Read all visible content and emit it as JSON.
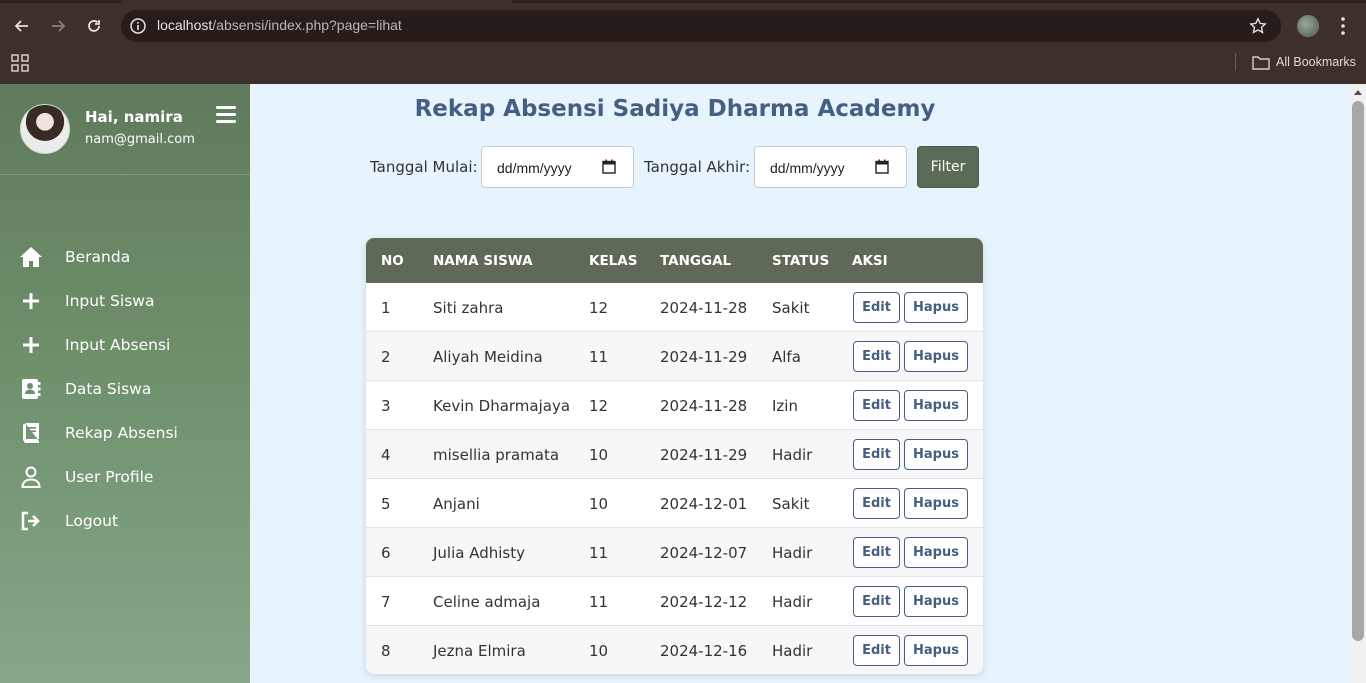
{
  "browser": {
    "url_host": "localhost",
    "url_path": "/absensi/index.php?page=lihat",
    "bookmarks_label": "All Bookmarks"
  },
  "sidebar": {
    "greeting": "Hai, namira",
    "email": "nam@gmail.com",
    "items": [
      {
        "label": "Beranda",
        "icon": "home-icon"
      },
      {
        "label": "Input Siswa",
        "icon": "plus-icon"
      },
      {
        "label": "Input Absensi",
        "icon": "plus-icon"
      },
      {
        "label": "Data Siswa",
        "icon": "address-book-icon"
      },
      {
        "label": "Rekap Absensi",
        "icon": "book-icon"
      },
      {
        "label": "User Profile",
        "icon": "user-icon"
      },
      {
        "label": "Logout",
        "icon": "logout-icon"
      }
    ]
  },
  "main": {
    "title": "Rekap Absensi Sadiya Dharma Academy",
    "filter": {
      "start_label": "Tanggal Mulai:",
      "end_label": "Tanggal Akhir:",
      "start_placeholder": "dd/mm/yyyy",
      "end_placeholder": "dd/mm/yyyy",
      "button": "Filter"
    },
    "table": {
      "columns": [
        "NO",
        "NAMA SISWA",
        "KELAS",
        "TANGGAL",
        "STATUS",
        "AKSI"
      ],
      "edit_label": "Edit",
      "delete_label": "Hapus",
      "rows": [
        {
          "no": "1",
          "nama": "Siti zahra",
          "kelas": "12",
          "tanggal": "2024-11-28",
          "status": "Sakit"
        },
        {
          "no": "2",
          "nama": "Aliyah Meidina",
          "kelas": "11",
          "tanggal": "2024-11-29",
          "status": "Alfa"
        },
        {
          "no": "3",
          "nama": "Kevin Dharmajaya",
          "kelas": "12",
          "tanggal": "2024-11-28",
          "status": "Izin"
        },
        {
          "no": "4",
          "nama": "misellia pramata",
          "kelas": "10",
          "tanggal": "2024-11-29",
          "status": "Hadir"
        },
        {
          "no": "5",
          "nama": "Anjani",
          "kelas": "10",
          "tanggal": "2024-12-01",
          "status": "Sakit"
        },
        {
          "no": "6",
          "nama": "Julia Adhisty",
          "kelas": "11",
          "tanggal": "2024-12-07",
          "status": "Hadir"
        },
        {
          "no": "7",
          "nama": "Celine admaja",
          "kelas": "11",
          "tanggal": "2024-12-12",
          "status": "Hadir"
        },
        {
          "no": "8",
          "nama": "Jezna Elmira",
          "kelas": "10",
          "tanggal": "2024-12-16",
          "status": "Hadir"
        }
      ]
    }
  },
  "colors": {
    "title": "#455f82",
    "table_header": "#5e6a57",
    "filter_button": "#5c6b58",
    "sidebar_top": "#5f7a5c",
    "sidebar_bottom": "#86a78a",
    "page_background": "#e7f3fd"
  }
}
